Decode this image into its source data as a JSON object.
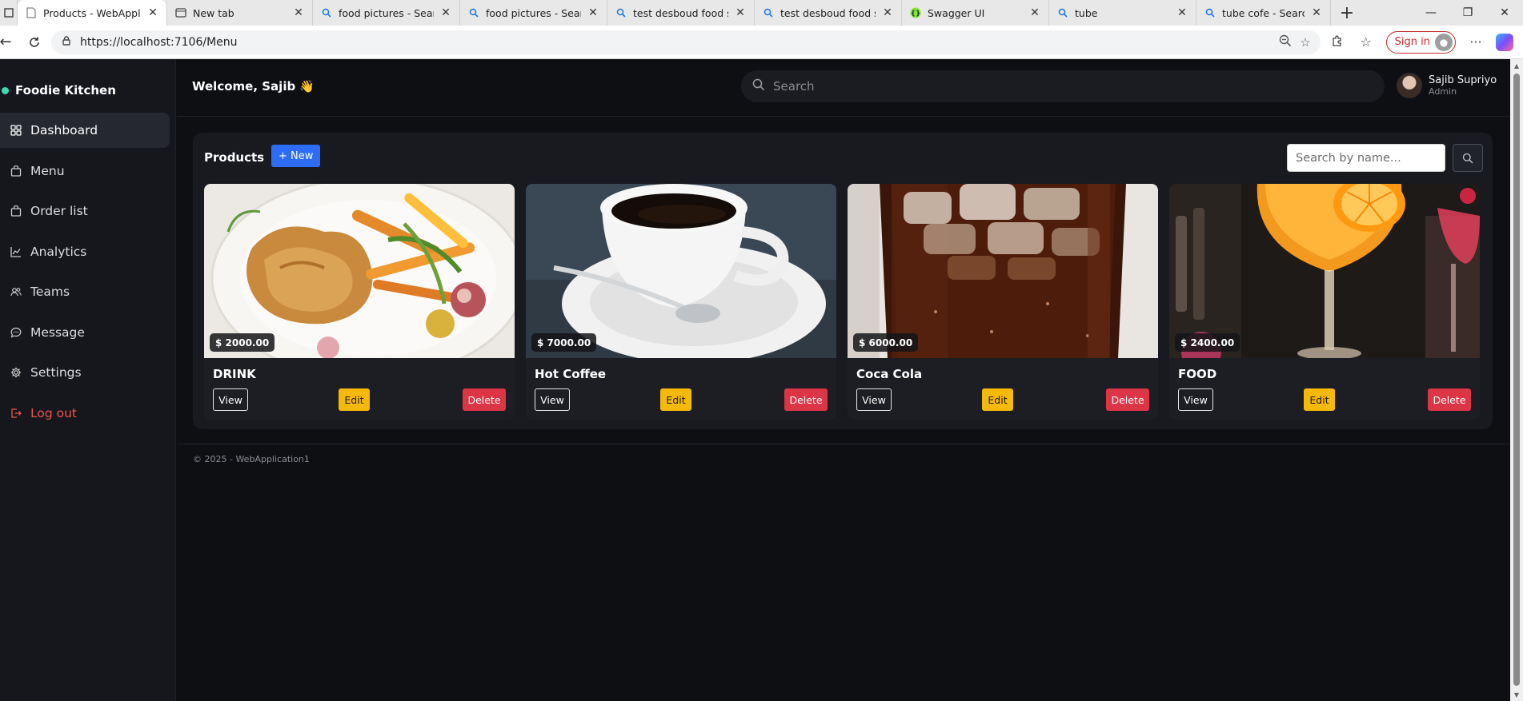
{
  "browser": {
    "tabs": [
      {
        "title": "Products - WebApplica",
        "icon": "page-icon",
        "active": true
      },
      {
        "title": "New tab",
        "icon": "newtab-icon"
      },
      {
        "title": "food pictures - Search",
        "icon": "search-icon"
      },
      {
        "title": "food pictures - Search I",
        "icon": "search-icon"
      },
      {
        "title": "test desboud food shop",
        "icon": "search-icon"
      },
      {
        "title": "test desboud food shop",
        "icon": "search-icon"
      },
      {
        "title": "Swagger UI",
        "icon": "swagger-icon"
      },
      {
        "title": "tube",
        "icon": "search-icon"
      },
      {
        "title": "tube cofe - Search Ima",
        "icon": "search-icon"
      }
    ],
    "url": "https://localhost:7106/Menu",
    "sign_in_label": "Sign in"
  },
  "sidebar": {
    "brand": "Foodie Kitchen",
    "brand_color": "#3ddbb0",
    "items": [
      {
        "label": "Dashboard",
        "icon": "grid-icon",
        "active": true
      },
      {
        "label": "Menu",
        "icon": "bag-icon"
      },
      {
        "label": "Order list",
        "icon": "bag-icon"
      },
      {
        "label": "Analytics",
        "icon": "chart-icon"
      },
      {
        "label": "Teams",
        "icon": "people-icon"
      },
      {
        "label": "Message",
        "icon": "chat-icon"
      },
      {
        "label": "Settings",
        "icon": "gear-icon"
      },
      {
        "label": "Log out",
        "icon": "logout-icon",
        "danger": true
      }
    ]
  },
  "header": {
    "welcome": "Welcome, Sajib 👋",
    "search_placeholder": "Search",
    "user_name": "Sajib Supriyo",
    "user_role": "Admin"
  },
  "products": {
    "title": "Products",
    "new_label": "+ New",
    "search_placeholder": "Search by name...",
    "view_label": "View",
    "edit_label": "Edit",
    "delete_label": "Delete",
    "items": [
      {
        "name": "DRINK",
        "price": "$ 2000.00",
        "image": "roast-chicken-with-vegetables"
      },
      {
        "name": "Hot Coffee",
        "price": "$ 7000.00",
        "image": "black-coffee-cup"
      },
      {
        "name": "Coca Cola",
        "price": "$ 6000.00",
        "image": "cola-glass-with-ice"
      },
      {
        "name": "FOOD",
        "price": "$ 2400.00",
        "image": "orange-cocktail"
      }
    ]
  },
  "footer": {
    "text": "© 2025 - WebApplication1"
  },
  "colors": {
    "accent": "#2d6df6",
    "edit": "#f5b90a",
    "delete": "#dc3545",
    "background": "#0e0f13"
  }
}
